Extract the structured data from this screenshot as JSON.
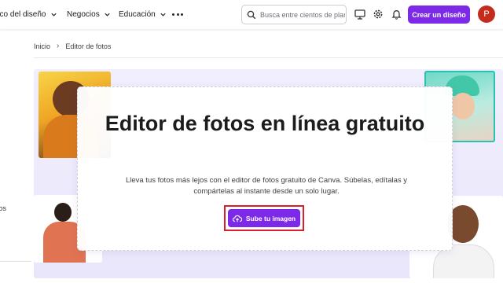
{
  "topbar": {
    "menu": [
      {
        "label": "oco del diseño"
      },
      {
        "label": "Negocios"
      },
      {
        "label": "Educación"
      }
    ],
    "search_placeholder": "Busca entre cientos de plan",
    "create_button": "Crear un diseño",
    "avatar_initial": "P",
    "icons": [
      "desktop-icon",
      "gear-icon",
      "bell-icon"
    ]
  },
  "breadcrumb": {
    "home": "Inicio",
    "current": "Editor de fotos"
  },
  "sidebar": {
    "partial_label": "itos"
  },
  "hero": {
    "title": "Editor de fotos en línea gratuito",
    "description": "Lleva tus fotos más lejos con el editor de fotos gratuito de Canva. Súbelas, edítalas y compártelas al instante desde un solo lugar.",
    "upload_button": "Sube tu imagen"
  },
  "colors": {
    "brand": "#7d2ae8",
    "highlight": "#d8202c",
    "avatar": "#c42d1e"
  }
}
